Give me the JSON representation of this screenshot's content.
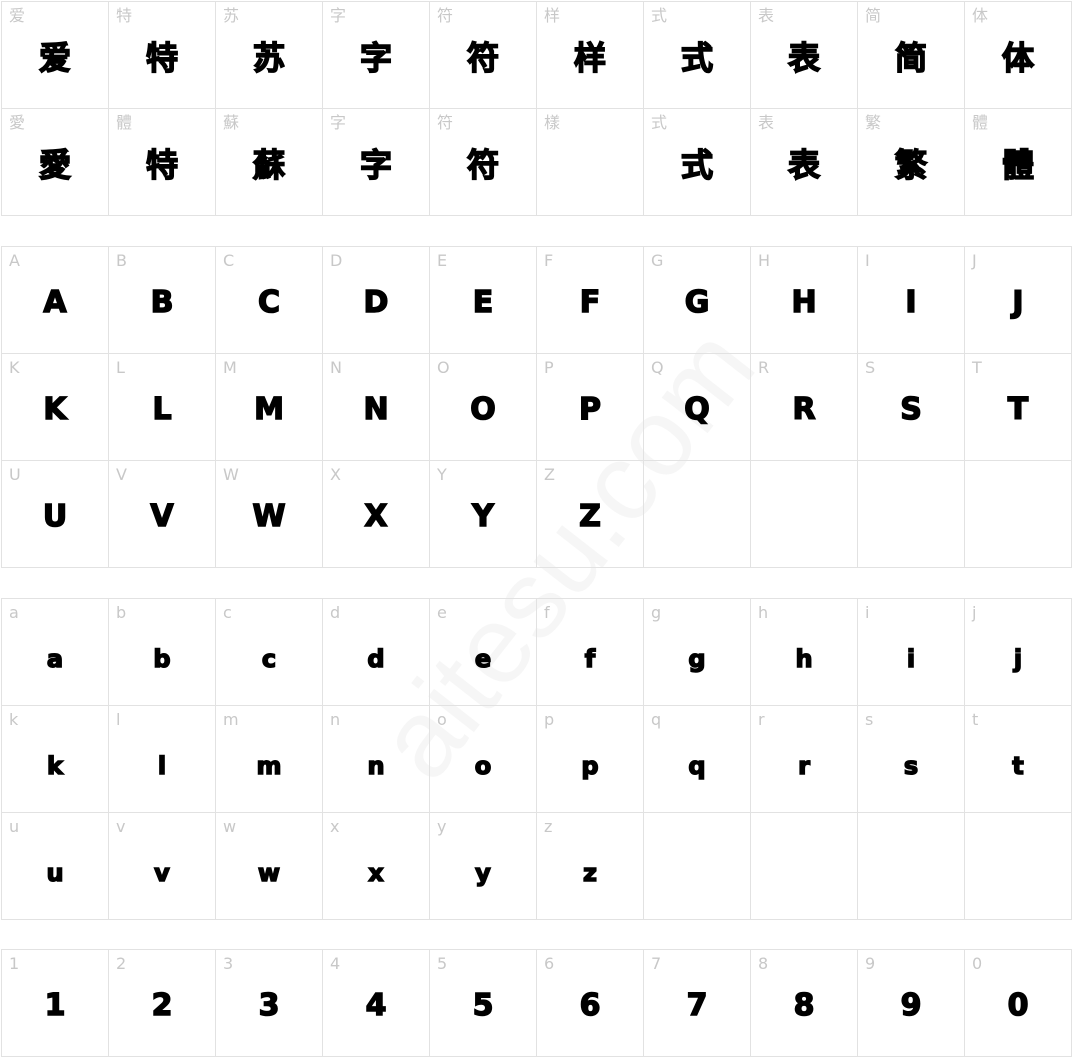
{
  "watermark": "aitesu.com",
  "sections": [
    {
      "name": "chinese",
      "cells": [
        {
          "label": "爱",
          "glyph": "爱"
        },
        {
          "label": "特",
          "glyph": "特"
        },
        {
          "label": "苏",
          "glyph": "苏"
        },
        {
          "label": "字",
          "glyph": "字"
        },
        {
          "label": "符",
          "glyph": "符"
        },
        {
          "label": "样",
          "glyph": "样"
        },
        {
          "label": "式",
          "glyph": "式"
        },
        {
          "label": "表",
          "glyph": "表"
        },
        {
          "label": "简",
          "glyph": "简"
        },
        {
          "label": "体",
          "glyph": "体"
        },
        {
          "label": "愛",
          "glyph": "愛"
        },
        {
          "label": "體",
          "glyph": "特"
        },
        {
          "label": "蘇",
          "glyph": "蘇"
        },
        {
          "label": "字",
          "glyph": "字"
        },
        {
          "label": "符",
          "glyph": "符"
        },
        {
          "label": "樣",
          "glyph": ""
        },
        {
          "label": "式",
          "glyph": "式"
        },
        {
          "label": "表",
          "glyph": "表"
        },
        {
          "label": "繁",
          "glyph": "繁"
        },
        {
          "label": "體",
          "glyph": "體"
        }
      ]
    },
    {
      "name": "uppercase",
      "cells": [
        {
          "label": "A",
          "glyph": "A"
        },
        {
          "label": "B",
          "glyph": "B"
        },
        {
          "label": "C",
          "glyph": "C"
        },
        {
          "label": "D",
          "glyph": "D"
        },
        {
          "label": "E",
          "glyph": "E"
        },
        {
          "label": "F",
          "glyph": "F"
        },
        {
          "label": "G",
          "glyph": "G"
        },
        {
          "label": "H",
          "glyph": "H"
        },
        {
          "label": "I",
          "glyph": "I"
        },
        {
          "label": "J",
          "glyph": "J"
        },
        {
          "label": "K",
          "glyph": "K"
        },
        {
          "label": "L",
          "glyph": "L"
        },
        {
          "label": "M",
          "glyph": "M"
        },
        {
          "label": "N",
          "glyph": "N"
        },
        {
          "label": "O",
          "glyph": "O"
        },
        {
          "label": "P",
          "glyph": "P"
        },
        {
          "label": "Q",
          "glyph": "Q"
        },
        {
          "label": "R",
          "glyph": "R"
        },
        {
          "label": "S",
          "glyph": "S"
        },
        {
          "label": "T",
          "glyph": "T"
        },
        {
          "label": "U",
          "glyph": "U"
        },
        {
          "label": "V",
          "glyph": "V"
        },
        {
          "label": "W",
          "glyph": "W"
        },
        {
          "label": "X",
          "glyph": "X"
        },
        {
          "label": "Y",
          "glyph": "Y"
        },
        {
          "label": "Z",
          "glyph": "Z"
        },
        {
          "label": "",
          "glyph": ""
        },
        {
          "label": "",
          "glyph": ""
        },
        {
          "label": "",
          "glyph": ""
        },
        {
          "label": "",
          "glyph": ""
        }
      ]
    },
    {
      "name": "lowercase",
      "cells": [
        {
          "label": "a",
          "glyph": "a"
        },
        {
          "label": "b",
          "glyph": "b"
        },
        {
          "label": "c",
          "glyph": "c"
        },
        {
          "label": "d",
          "glyph": "d"
        },
        {
          "label": "e",
          "glyph": "e"
        },
        {
          "label": "f",
          "glyph": "f"
        },
        {
          "label": "g",
          "glyph": "g"
        },
        {
          "label": "h",
          "glyph": "h"
        },
        {
          "label": "i",
          "glyph": "i"
        },
        {
          "label": "j",
          "glyph": "j"
        },
        {
          "label": "k",
          "glyph": "k"
        },
        {
          "label": "l",
          "glyph": "l"
        },
        {
          "label": "m",
          "glyph": "m"
        },
        {
          "label": "n",
          "glyph": "n"
        },
        {
          "label": "o",
          "glyph": "o"
        },
        {
          "label": "p",
          "glyph": "p"
        },
        {
          "label": "q",
          "glyph": "q"
        },
        {
          "label": "r",
          "glyph": "r"
        },
        {
          "label": "s",
          "glyph": "s"
        },
        {
          "label": "t",
          "glyph": "t"
        },
        {
          "label": "u",
          "glyph": "u"
        },
        {
          "label": "v",
          "glyph": "v"
        },
        {
          "label": "w",
          "glyph": "w"
        },
        {
          "label": "x",
          "glyph": "x"
        },
        {
          "label": "y",
          "glyph": "y"
        },
        {
          "label": "z",
          "glyph": "z"
        },
        {
          "label": "",
          "glyph": ""
        },
        {
          "label": "",
          "glyph": ""
        },
        {
          "label": "",
          "glyph": ""
        },
        {
          "label": "",
          "glyph": ""
        }
      ]
    },
    {
      "name": "digits",
      "cells": [
        {
          "label": "1",
          "glyph": "1"
        },
        {
          "label": "2",
          "glyph": "2"
        },
        {
          "label": "3",
          "glyph": "3"
        },
        {
          "label": "4",
          "glyph": "4"
        },
        {
          "label": "5",
          "glyph": "5"
        },
        {
          "label": "6",
          "glyph": "6"
        },
        {
          "label": "7",
          "glyph": "7"
        },
        {
          "label": "8",
          "glyph": "8"
        },
        {
          "label": "9",
          "glyph": "9"
        },
        {
          "label": "0",
          "glyph": "0"
        }
      ]
    }
  ]
}
